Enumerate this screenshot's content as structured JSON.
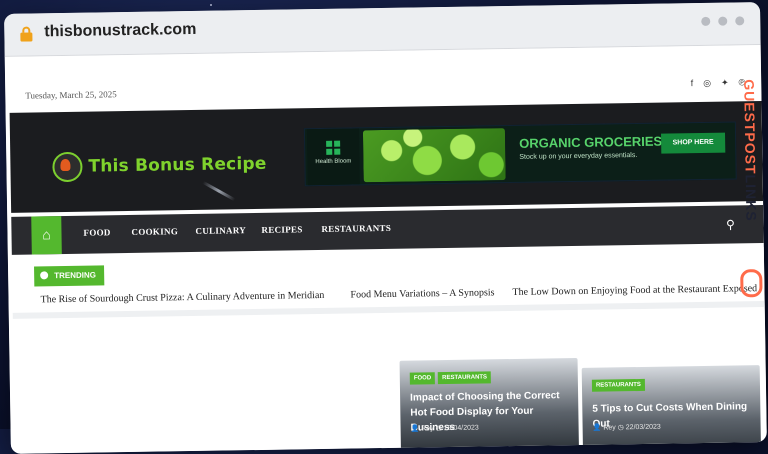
{
  "browser": {
    "url": "thisbonustrack.com"
  },
  "site": {
    "date": "Tuesday, March 25, 2025",
    "logo_text": "This Bonus Recipe",
    "social_icons": [
      "facebook-icon",
      "instagram-icon",
      "twitter-icon",
      "pinterest-icon"
    ]
  },
  "ad": {
    "brand": "Health Bloom",
    "title": "ORGANIC GROCERIES",
    "subtitle": "Stock up on your everyday essentials.",
    "button": "SHOP HERE"
  },
  "nav": {
    "items": [
      "FOOD",
      "COOKING",
      "CULINARY",
      "RECIPES",
      "RESTAURANTS"
    ]
  },
  "trending": {
    "label": "TRENDING",
    "items": [
      "The Rise of Sourdough Crust Pizza: A Culinary Adventure in Meridian",
      "Food Menu Variations – A Synopsis",
      "The Low Down on Enjoying Food at the Restaurant Exposed"
    ]
  },
  "cards": [
    {
      "tags": [
        "FOOD",
        "RESTAURANTS"
      ],
      "title": "Impact of Choosing the Correct Hot Food Display for Your Business",
      "author": "Rey",
      "date": "15/04/2023"
    },
    {
      "tags": [
        "RESTAURANTS"
      ],
      "title": "5 Tips to Cut Costs When Dining Out",
      "author": "Rey",
      "date": "22/03/2023"
    }
  ],
  "watermark": {
    "text_a": "GUESTPOST",
    "text_b": "LINKS"
  },
  "colors": {
    "accent": "#54b82e",
    "header_bg": "#1b1c1f",
    "nav_bg": "#2a2b2f"
  }
}
